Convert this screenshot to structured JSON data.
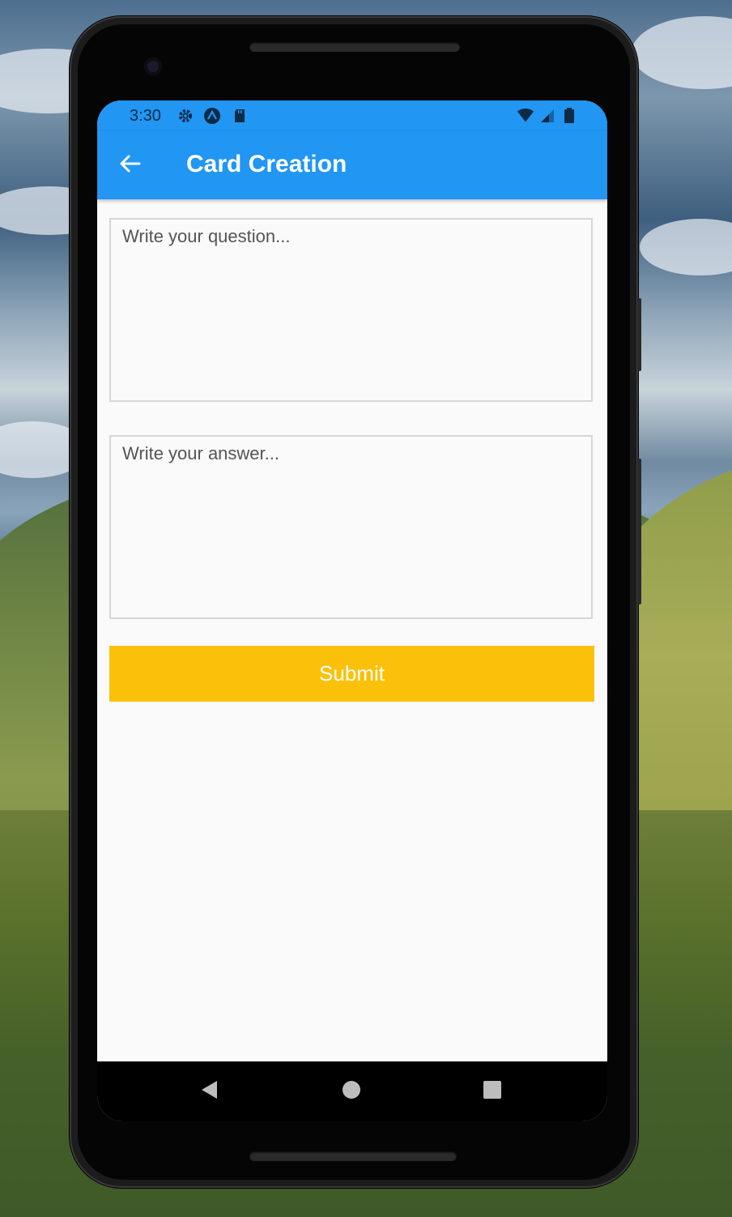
{
  "status_bar": {
    "time": "3:30",
    "icons": [
      "gear-icon",
      "app-logo-icon",
      "sd-card-icon"
    ],
    "right_icons": [
      "wifi-icon",
      "signal-icon",
      "battery-icon"
    ]
  },
  "appbar": {
    "title": "Card Creation",
    "back_icon": "arrow-left-icon"
  },
  "form": {
    "question_placeholder": "Write your question...",
    "question_value": "",
    "answer_placeholder": "Write your answer...",
    "answer_value": "",
    "submit_label": "Submit"
  },
  "nav": {
    "back_icon": "triangle-back-icon",
    "home_icon": "circle-home-icon",
    "recents_icon": "square-recents-icon"
  },
  "colors": {
    "appbar": "#2196f3",
    "submit": "#fbc10a",
    "background": "#fafafa"
  }
}
